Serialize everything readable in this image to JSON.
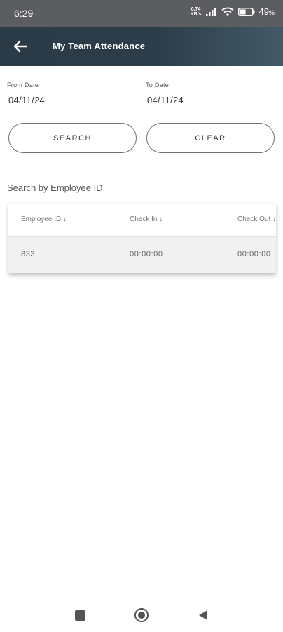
{
  "status_bar": {
    "time": "6:29",
    "net_speed_value": "0.74",
    "net_speed_unit": "KB/s",
    "battery_value": "49",
    "battery_unit": "%",
    "battery_level": 0.49
  },
  "app_bar": {
    "title": "My Team Attendance",
    "back_icon": "arrow-left-icon"
  },
  "filters": {
    "from_label": "From Date",
    "from_value": "04/11/24",
    "to_label": "To Date",
    "to_value": "04/11/24",
    "search_label": "SEARCH",
    "clear_label": "CLEAR"
  },
  "search_employee_label": "Search by Employee ID",
  "table": {
    "headers": [
      "Employee ID ↕",
      "Check In ↕",
      "Check Out ↕"
    ],
    "rows": [
      [
        "833",
        "00:00:00",
        "00:00:00"
      ]
    ]
  },
  "colors": {
    "status_bar": "#5b5d60",
    "app_bar": "#2c3d4a",
    "row_background": "#f1f1f1"
  }
}
